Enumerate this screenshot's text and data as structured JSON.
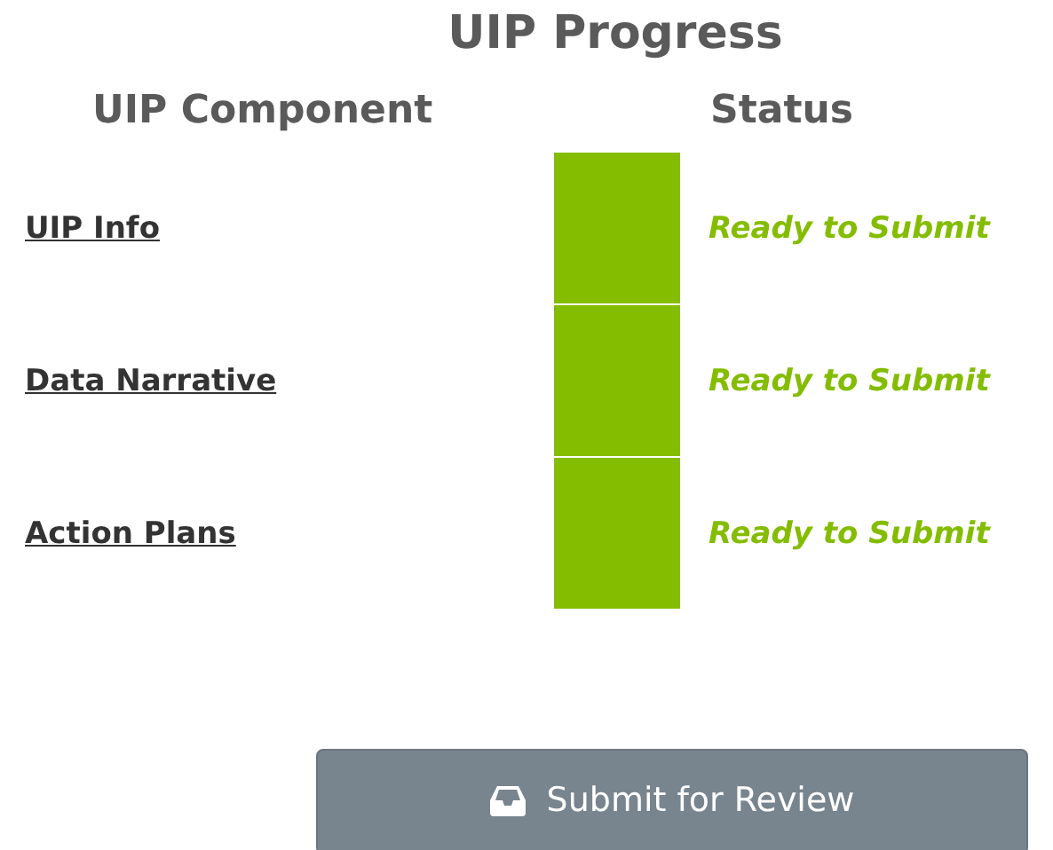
{
  "title": "UIP Progress",
  "columns": [
    "UIP Component",
    "Status"
  ],
  "rows": [
    {
      "label": "UIP Info",
      "color": "#84bd00",
      "status": "Ready to Submit"
    },
    {
      "label": "Data Narrative",
      "color": "#84bd00",
      "status": "Ready to Submit"
    },
    {
      "label": "Action Plans",
      "color": "#84bd00",
      "status": "Ready to Submit"
    }
  ],
  "submit_button": {
    "label": "Submit for Review"
  }
}
